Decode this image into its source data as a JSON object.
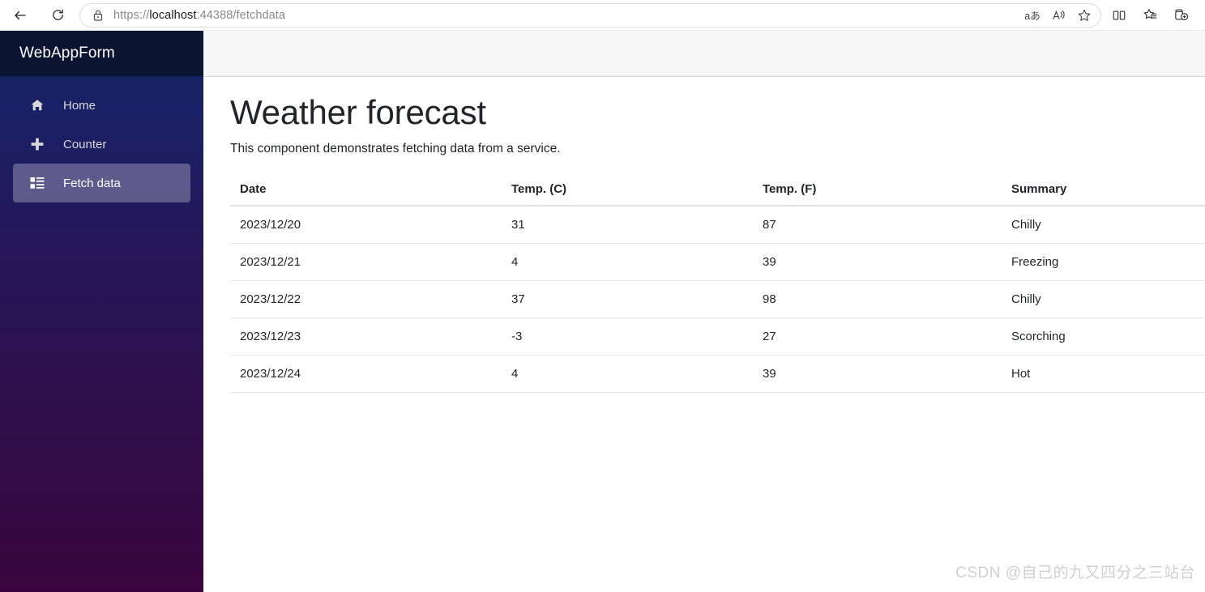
{
  "browser": {
    "back_label": "Back",
    "refresh_label": "Refresh",
    "site_info_icon": "lock-icon",
    "url": {
      "scheme": "https://",
      "host": "localhost",
      "rest": ":44388/fetchdata",
      "full": "https://localhost:44388/fetchdata"
    },
    "address_actions": [
      {
        "name": "translate-icon",
        "label": "aあ"
      },
      {
        "name": "read-aloud-icon",
        "label": "A"
      },
      {
        "name": "add-favorite-icon",
        "label": "☆"
      }
    ],
    "toolbar_right": [
      {
        "name": "split-screen-icon",
        "label": "Split screen"
      },
      {
        "name": "favorites-list-icon",
        "label": "Favorites"
      },
      {
        "name": "collections-icon",
        "label": "Collections"
      }
    ]
  },
  "sidebar": {
    "brand": "WebAppForm",
    "items": [
      {
        "label": "Home",
        "icon": "home-icon",
        "active": false
      },
      {
        "label": "Counter",
        "icon": "plus-icon",
        "active": false
      },
      {
        "label": "Fetch data",
        "icon": "list-rich-icon",
        "active": true
      }
    ],
    "colors": {
      "header_bg": "#0b1430",
      "gradient_top": "#11245c",
      "gradient_bottom": "#3a053e",
      "active_item_bg": "rgba(255,255,255,0.28)"
    }
  },
  "main": {
    "title": "Weather forecast",
    "subtitle": "This component demonstrates fetching data from a service.",
    "table": {
      "headers": [
        "Date",
        "Temp. (C)",
        "Temp. (F)",
        "Summary"
      ],
      "rows": [
        {
          "date": "2023/12/20",
          "temp_c": "31",
          "temp_f": "87",
          "summary": "Chilly"
        },
        {
          "date": "2023/12/21",
          "temp_c": "4",
          "temp_f": "39",
          "summary": "Freezing"
        },
        {
          "date": "2023/12/22",
          "temp_c": "37",
          "temp_f": "98",
          "summary": "Chilly"
        },
        {
          "date": "2023/12/23",
          "temp_c": "-3",
          "temp_f": "27",
          "summary": "Scorching"
        },
        {
          "date": "2023/12/24",
          "temp_c": "4",
          "temp_f": "39",
          "summary": "Hot"
        }
      ]
    }
  },
  "watermark": "CSDN @自己的九又四分之三站台"
}
